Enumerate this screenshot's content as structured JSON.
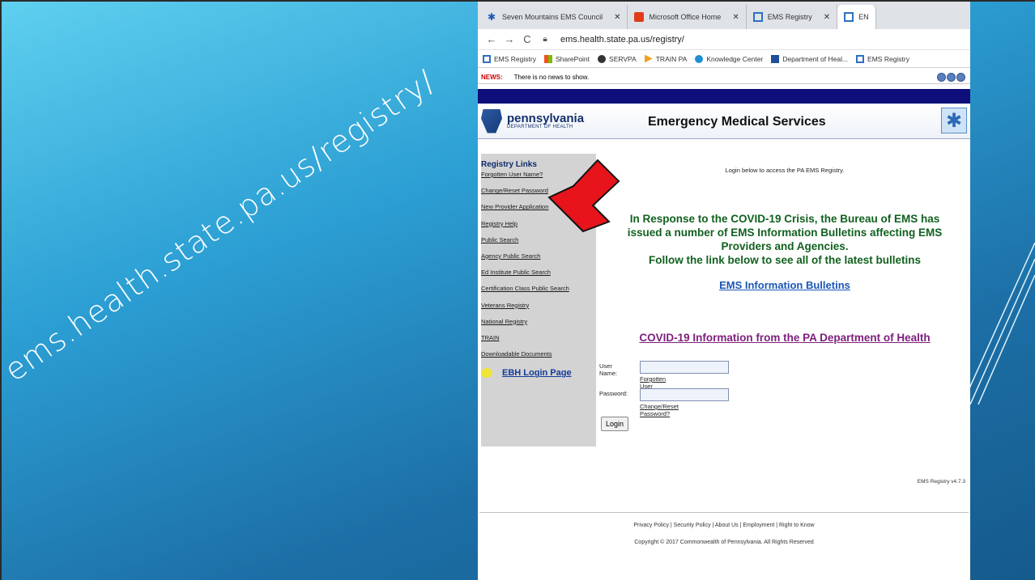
{
  "slide": {
    "caption": "ems.health.state.pa.us/registry/"
  },
  "browser": {
    "tabs": [
      {
        "label": "Seven Mountains EMS Council",
        "icon": "star-of-life-icon"
      },
      {
        "label": "Microsoft Office Home",
        "icon": "office-icon"
      },
      {
        "label": "EMS Registry",
        "icon": "registry-icon"
      },
      {
        "label": "EN",
        "icon": "registry-icon"
      }
    ],
    "url": "ems.health.state.pa.us/registry/",
    "bookmarks": [
      "EMS Registry",
      "SharePoint",
      "SERVPA",
      "TRAIN PA",
      "Knowledge Center",
      "Department of Heal...",
      "EMS Registry"
    ]
  },
  "page": {
    "news_label": "NEWS:",
    "news_text": "There is no news to show.",
    "pa_name": "pennsylvania",
    "pa_sub": "DEPARTMENT OF HEALTH",
    "title": "Emergency Medical Services",
    "sidebar": {
      "title": "Registry Links",
      "links": [
        "Forgotten User Name?",
        "Change/Reset Password",
        "New Provider Application",
        "Registry Help",
        "Public Search",
        "Agency Public Search",
        "Ed Institute Public Search",
        "Certification Class Public Search",
        "Veterans Registry",
        "National Registry",
        "TRAIN",
        "Downloadable Documents"
      ],
      "ebh": "EBH Login Page"
    },
    "login_intro": "Login below to access the PA EMS Registry.",
    "covid_line1": "In Response to the COVID-19 Crisis, the Bureau of EMS has",
    "covid_line2": "issued a number of EMS Information Bulletins affecting EMS",
    "covid_line3": "Providers and Agencies.",
    "covid_line4": "Follow the link below to see all of the latest bulletins",
    "bulletins_link": "EMS Information Bulletins",
    "doh_link": "COVID-19 Information from the PA Department of Health",
    "form": {
      "username_label": "User Name:",
      "forgot_username": "Forgotten User Name?",
      "password_label": "Password:",
      "reset_password": "Change/Reset Password?",
      "login_button": "Login"
    },
    "version": "EMS Registry v4.7.3",
    "footer_links": "Privacy Policy | Security Policy | About Us | Employment | Right to Know",
    "copyright": "Copyright © 2017 Commonwealth of Pennsylvania. All Rights Reserved"
  },
  "colors": {
    "slide_bg": "#2c9fd4",
    "sidebar_bg": "#d3d3d3",
    "covid_green": "#11611f",
    "arrow_red": "#e8141b"
  }
}
